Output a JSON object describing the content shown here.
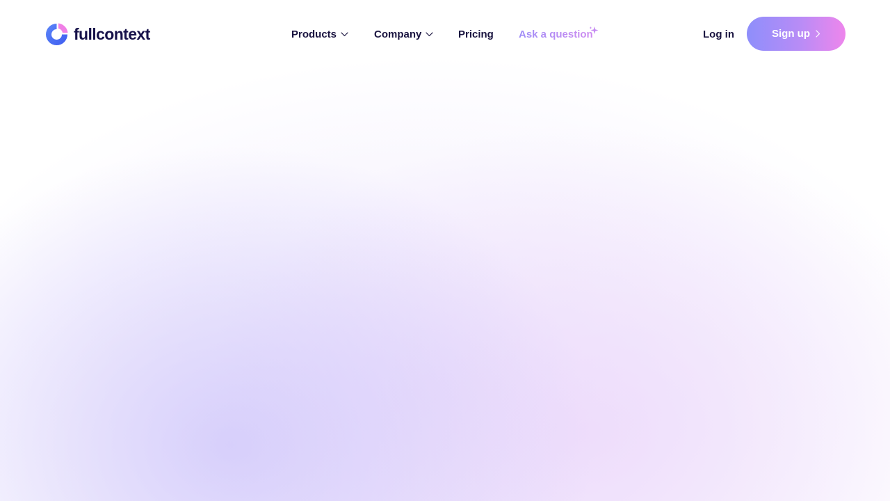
{
  "brand": {
    "name": "fullcontext",
    "colors": {
      "blue": "#4f6ef7",
      "pink": "#f07fe6",
      "dark": "#17124a"
    }
  },
  "nav": {
    "products": "Products",
    "company": "Company",
    "pricing": "Pricing",
    "ask": "Ask a question",
    "ask_icon": "sparkle-icon"
  },
  "auth": {
    "login": "Log in",
    "signup": "Sign up"
  },
  "colors": {
    "nav_text": "#1a1440",
    "ask_gradient": [
      "#9f8cf7",
      "#cf8df0"
    ],
    "signup_gradient": [
      "#8e8efb",
      "#ee86ec"
    ],
    "background_tint": "#e4dcfb"
  }
}
